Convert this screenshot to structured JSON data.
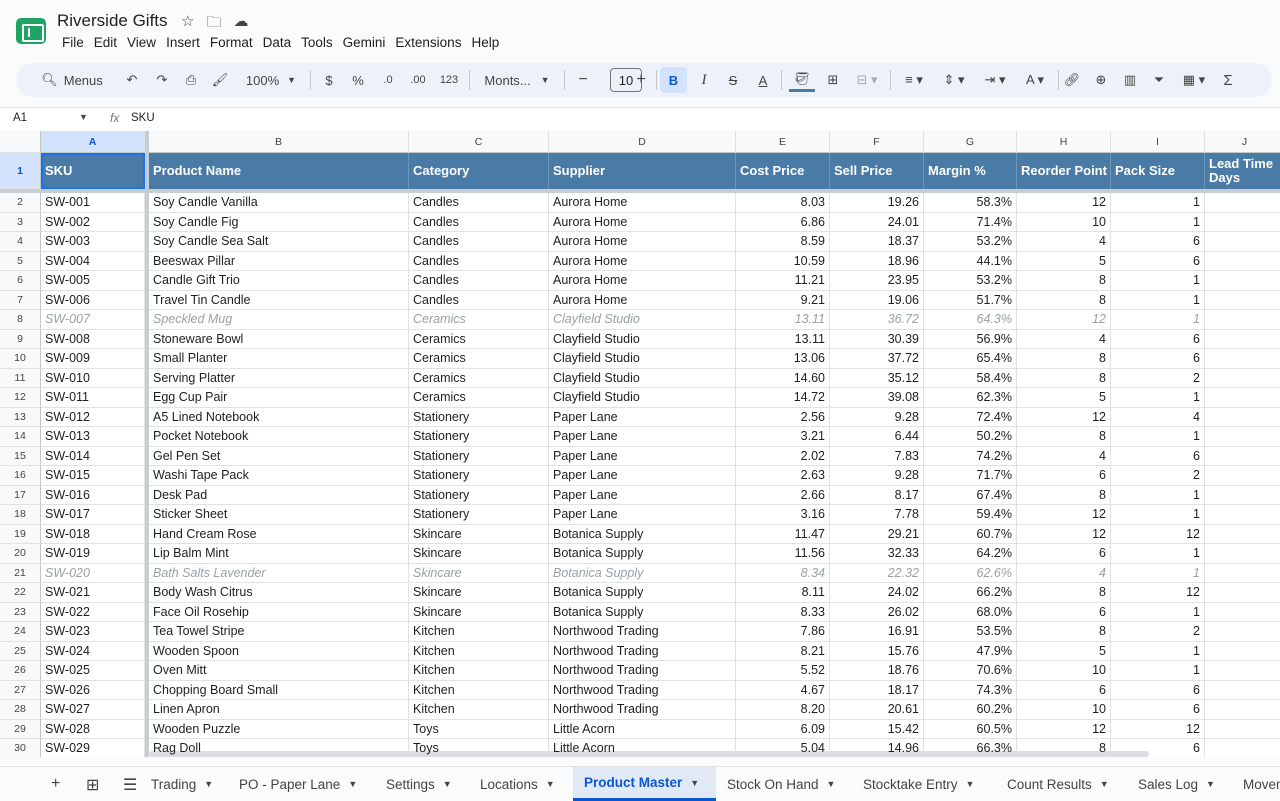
{
  "app": {
    "title": "Riverside Gifts",
    "menu": [
      "File",
      "Edit",
      "View",
      "Insert",
      "Format",
      "Data",
      "Tools",
      "Gemini",
      "Extensions",
      "Help"
    ]
  },
  "toolbar": {
    "menus_label": "Menus",
    "zoom": "100%",
    "currency": "$",
    "percent": "%",
    "dec_less": ".0",
    "dec_more": ".00",
    "number_format": "123",
    "font": "Monts...",
    "font_size": "10",
    "bold": "B",
    "italic": "I",
    "strike": "S",
    "text_color": "A",
    "sigma": "Σ"
  },
  "formula_bar": {
    "cell_ref": "A1",
    "fx": "fx",
    "value": "SKU"
  },
  "columns": [
    "A",
    "B",
    "C",
    "D",
    "E",
    "F",
    "G",
    "H",
    "I",
    "J"
  ],
  "header_row": [
    "SKU",
    "Product Name",
    "Category",
    "Supplier",
    "Cost Price",
    "Sell Price",
    "Margin %",
    "Reorder Point",
    "Pack Size",
    "Lead Time Days"
  ],
  "rows": [
    {
      "n": "2",
      "muted": false,
      "c": [
        "SW-001",
        "Soy Candle Vanilla",
        "Candles",
        "Aurora Home",
        "8.03",
        "19.26",
        "58.3%",
        "12",
        "1"
      ]
    },
    {
      "n": "3",
      "muted": false,
      "c": [
        "SW-002",
        "Soy Candle Fig",
        "Candles",
        "Aurora Home",
        "6.86",
        "24.01",
        "71.4%",
        "10",
        "1"
      ]
    },
    {
      "n": "4",
      "muted": false,
      "c": [
        "SW-003",
        "Soy Candle Sea Salt",
        "Candles",
        "Aurora Home",
        "8.59",
        "18.37",
        "53.2%",
        "4",
        "6"
      ]
    },
    {
      "n": "5",
      "muted": false,
      "c": [
        "SW-004",
        "Beeswax Pillar",
        "Candles",
        "Aurora Home",
        "10.59",
        "18.96",
        "44.1%",
        "5",
        "6"
      ]
    },
    {
      "n": "6",
      "muted": false,
      "c": [
        "SW-005",
        "Candle Gift Trio",
        "Candles",
        "Aurora Home",
        "11.21",
        "23.95",
        "53.2%",
        "8",
        "1"
      ]
    },
    {
      "n": "7",
      "muted": false,
      "c": [
        "SW-006",
        "Travel Tin Candle",
        "Candles",
        "Aurora Home",
        "9.21",
        "19.06",
        "51.7%",
        "8",
        "1"
      ]
    },
    {
      "n": "8",
      "muted": true,
      "c": [
        "SW-007",
        "Speckled Mug",
        "Ceramics",
        "Clayfield Studio",
        "13.11",
        "36.72",
        "64.3%",
        "12",
        "1"
      ]
    },
    {
      "n": "9",
      "muted": false,
      "c": [
        "SW-008",
        "Stoneware Bowl",
        "Ceramics",
        "Clayfield Studio",
        "13.11",
        "30.39",
        "56.9%",
        "4",
        "6"
      ]
    },
    {
      "n": "10",
      "muted": false,
      "c": [
        "SW-009",
        "Small Planter",
        "Ceramics",
        "Clayfield Studio",
        "13.06",
        "37.72",
        "65.4%",
        "8",
        "6"
      ]
    },
    {
      "n": "11",
      "muted": false,
      "c": [
        "SW-010",
        "Serving Platter",
        "Ceramics",
        "Clayfield Studio",
        "14.60",
        "35.12",
        "58.4%",
        "8",
        "2"
      ]
    },
    {
      "n": "12",
      "muted": false,
      "c": [
        "SW-011",
        "Egg Cup Pair",
        "Ceramics",
        "Clayfield Studio",
        "14.72",
        "39.08",
        "62.3%",
        "5",
        "1"
      ]
    },
    {
      "n": "13",
      "muted": false,
      "c": [
        "SW-012",
        "A5 Lined Notebook",
        "Stationery",
        "Paper Lane",
        "2.56",
        "9.28",
        "72.4%",
        "12",
        "4"
      ]
    },
    {
      "n": "14",
      "muted": false,
      "c": [
        "SW-013",
        "Pocket Notebook",
        "Stationery",
        "Paper Lane",
        "3.21",
        "6.44",
        "50.2%",
        "8",
        "1"
      ]
    },
    {
      "n": "15",
      "muted": false,
      "c": [
        "SW-014",
        "Gel Pen Set",
        "Stationery",
        "Paper Lane",
        "2.02",
        "7.83",
        "74.2%",
        "4",
        "6"
      ]
    },
    {
      "n": "16",
      "muted": false,
      "c": [
        "SW-015",
        "Washi Tape Pack",
        "Stationery",
        "Paper Lane",
        "2.63",
        "9.28",
        "71.7%",
        "6",
        "2"
      ]
    },
    {
      "n": "17",
      "muted": false,
      "c": [
        "SW-016",
        "Desk Pad",
        "Stationery",
        "Paper Lane",
        "2.66",
        "8.17",
        "67.4%",
        "8",
        "1"
      ]
    },
    {
      "n": "18",
      "muted": false,
      "c": [
        "SW-017",
        "Sticker Sheet",
        "Stationery",
        "Paper Lane",
        "3.16",
        "7.78",
        "59.4%",
        "12",
        "1"
      ]
    },
    {
      "n": "19",
      "muted": false,
      "c": [
        "SW-018",
        "Hand Cream Rose",
        "Skincare",
        "Botanica Supply",
        "11.47",
        "29.21",
        "60.7%",
        "12",
        "12"
      ]
    },
    {
      "n": "20",
      "muted": false,
      "c": [
        "SW-019",
        "Lip Balm Mint",
        "Skincare",
        "Botanica Supply",
        "11.56",
        "32.33",
        "64.2%",
        "6",
        "1"
      ]
    },
    {
      "n": "21",
      "muted": true,
      "c": [
        "SW-020",
        "Bath Salts Lavender",
        "Skincare",
        "Botanica Supply",
        "8.34",
        "22.32",
        "62.6%",
        "4",
        "1"
      ]
    },
    {
      "n": "22",
      "muted": false,
      "c": [
        "SW-021",
        "Body Wash Citrus",
        "Skincare",
        "Botanica Supply",
        "8.11",
        "24.02",
        "66.2%",
        "8",
        "12"
      ]
    },
    {
      "n": "23",
      "muted": false,
      "c": [
        "SW-022",
        "Face Oil Rosehip",
        "Skincare",
        "Botanica Supply",
        "8.33",
        "26.02",
        "68.0%",
        "6",
        "1"
      ]
    },
    {
      "n": "24",
      "muted": false,
      "c": [
        "SW-023",
        "Tea Towel Stripe",
        "Kitchen",
        "Northwood Trading",
        "7.86",
        "16.91",
        "53.5%",
        "8",
        "2"
      ]
    },
    {
      "n": "25",
      "muted": false,
      "c": [
        "SW-024",
        "Wooden Spoon",
        "Kitchen",
        "Northwood Trading",
        "8.21",
        "15.76",
        "47.9%",
        "5",
        "1"
      ]
    },
    {
      "n": "26",
      "muted": false,
      "c": [
        "SW-025",
        "Oven Mitt",
        "Kitchen",
        "Northwood Trading",
        "5.52",
        "18.76",
        "70.6%",
        "10",
        "1"
      ]
    },
    {
      "n": "27",
      "muted": false,
      "c": [
        "SW-026",
        "Chopping Board Small",
        "Kitchen",
        "Northwood Trading",
        "4.67",
        "18.17",
        "74.3%",
        "6",
        "6"
      ]
    },
    {
      "n": "28",
      "muted": false,
      "c": [
        "SW-027",
        "Linen Apron",
        "Kitchen",
        "Northwood Trading",
        "8.20",
        "20.61",
        "60.2%",
        "10",
        "6"
      ]
    },
    {
      "n": "29",
      "muted": false,
      "c": [
        "SW-028",
        "Wooden Puzzle",
        "Toys",
        "Little Acorn",
        "6.09",
        "15.42",
        "60.5%",
        "12",
        "12"
      ]
    },
    {
      "n": "30",
      "muted": false,
      "c": [
        "SW-029",
        "Rag Doll",
        "Toys",
        "Little Acorn",
        "5.04",
        "14.96",
        "66.3%",
        "8",
        "6"
      ]
    }
  ],
  "sheet_tabs": [
    "Trading",
    "PO - Paper Lane",
    "Settings",
    "Locations",
    "Product Master",
    "Stock On Hand",
    "Stocktake Entry",
    "Count Results",
    "Sales Log",
    "Movem"
  ],
  "active_tab": "Product Master",
  "colors": {
    "header_fill": "#4a7ba7",
    "active_tab": "#0b57d0",
    "muted_text": "#9aa0a6"
  }
}
